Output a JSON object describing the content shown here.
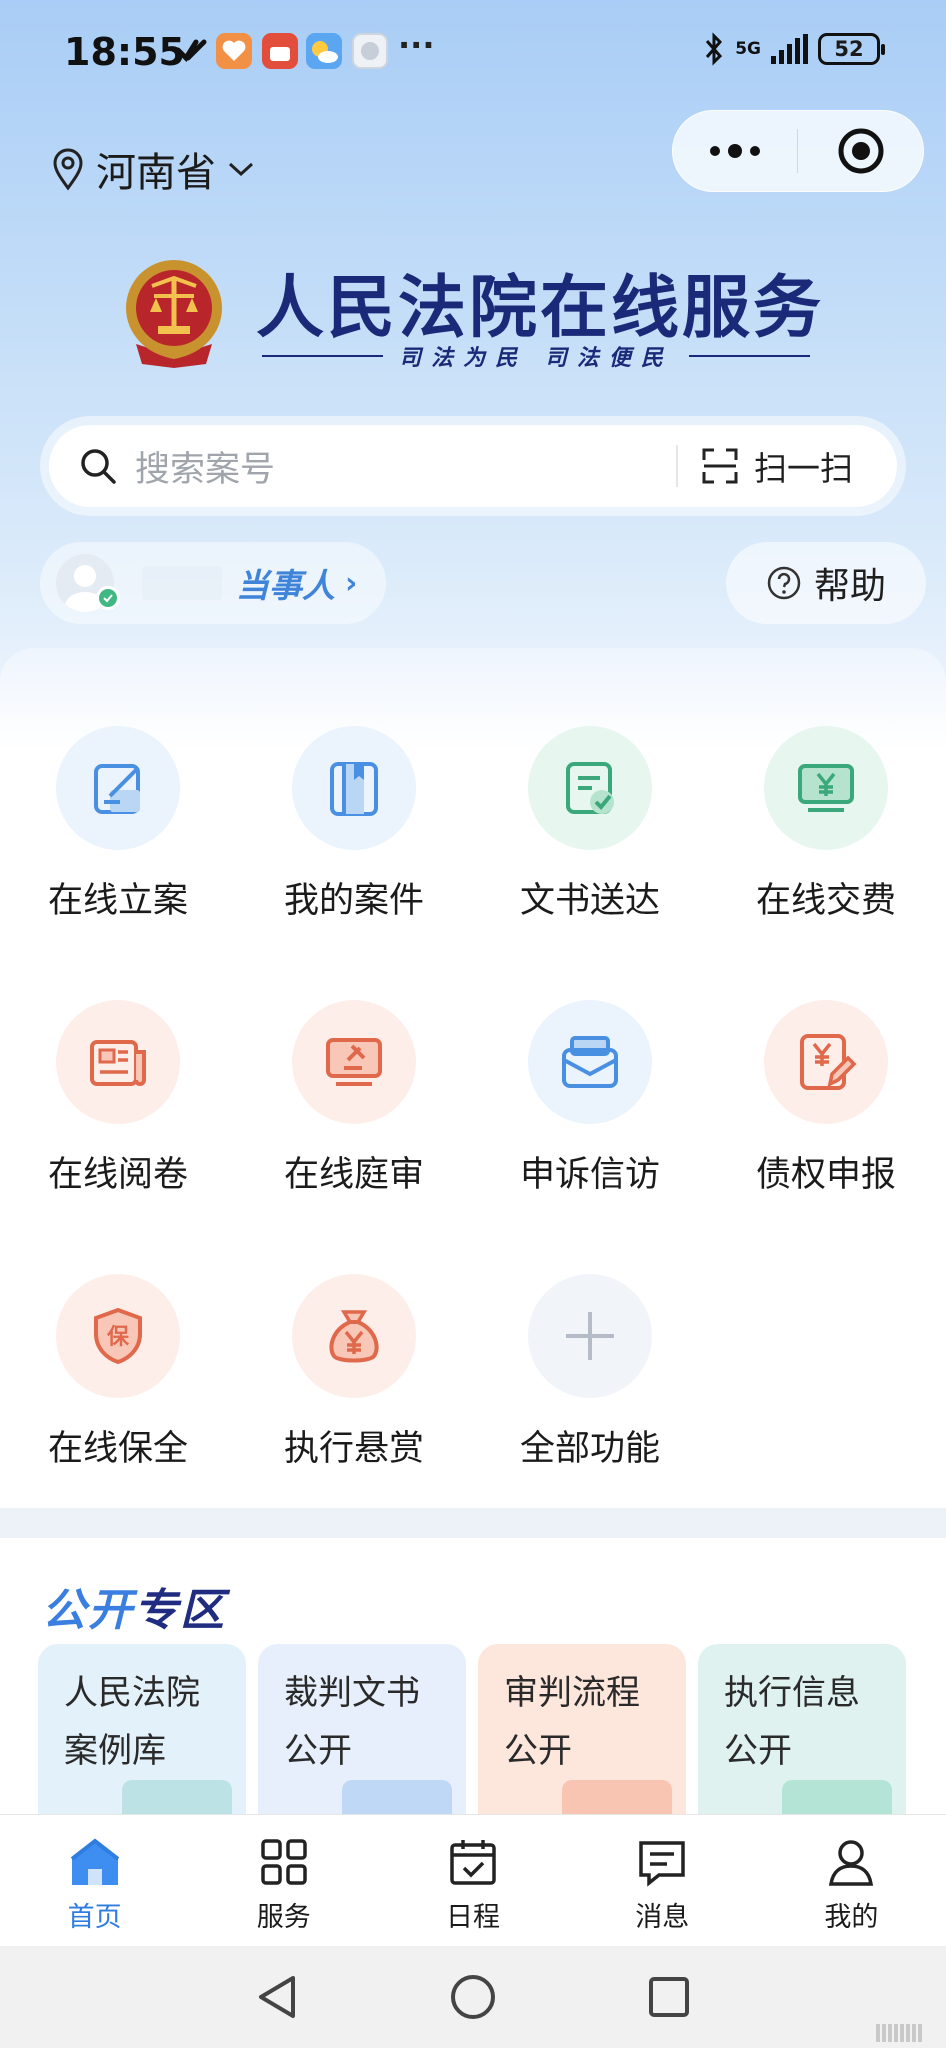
{
  "status_bar": {
    "time": "18:55",
    "network": "5G",
    "battery": "52",
    "more": "···"
  },
  "location": {
    "province": "河南省"
  },
  "header": {
    "title": "人民法院在线服务",
    "slogan": "司法为民  司法便民"
  },
  "search": {
    "placeholder": "搜索案号",
    "scan_label": "扫一扫"
  },
  "user": {
    "role": "当事人",
    "arrow": "›"
  },
  "help": {
    "label": "帮助"
  },
  "services": [
    {
      "label": "在线立案",
      "icon": "edit-form-icon",
      "tone": "blue"
    },
    {
      "label": "我的案件",
      "icon": "case-book-icon",
      "tone": "blue"
    },
    {
      "label": "文书送达",
      "icon": "document-check-icon",
      "tone": "green"
    },
    {
      "label": "在线交费",
      "icon": "yuan-monitor-icon",
      "tone": "green"
    },
    {
      "label": "在线阅卷",
      "icon": "newspaper-icon",
      "tone": "red"
    },
    {
      "label": "在线庭审",
      "icon": "gavel-screen-icon",
      "tone": "red"
    },
    {
      "label": "申诉信访",
      "icon": "mailbox-icon",
      "tone": "blue"
    },
    {
      "label": "债权申报",
      "icon": "yuan-edit-icon",
      "tone": "red"
    },
    {
      "label": "在线保全",
      "icon": "shield-bao-icon",
      "tone": "red"
    },
    {
      "label": "执行悬赏",
      "icon": "money-bag-icon",
      "tone": "red"
    },
    {
      "label": "全部功能",
      "icon": "plus-icon",
      "tone": "blue"
    }
  ],
  "public_zone": {
    "title_a": "公开",
    "title_b": "专区",
    "cards": [
      {
        "text": "人民法院案例库",
        "bg": "#e3f1fa"
      },
      {
        "text": "裁判文书公开",
        "bg": "#e6effb"
      },
      {
        "text": "审判流程公开",
        "bg": "#fde7dc"
      },
      {
        "text": "执行信息公开",
        "bg": "#dff2f0"
      }
    ]
  },
  "tabbar": [
    {
      "label": "首页",
      "icon": "home-icon",
      "active": true
    },
    {
      "label": "服务",
      "icon": "grid-icon",
      "active": false
    },
    {
      "label": "日程",
      "icon": "calendar-icon",
      "active": false
    },
    {
      "label": "消息",
      "icon": "message-icon",
      "active": false
    },
    {
      "label": "我的",
      "icon": "user-icon",
      "active": false
    }
  ],
  "colors": {
    "accent": "#2f7de1",
    "title_navy": "#1b2a78",
    "icon_blue": "#4a90e2",
    "icon_green": "#3aa87a",
    "icon_red": "#e0684b"
  }
}
